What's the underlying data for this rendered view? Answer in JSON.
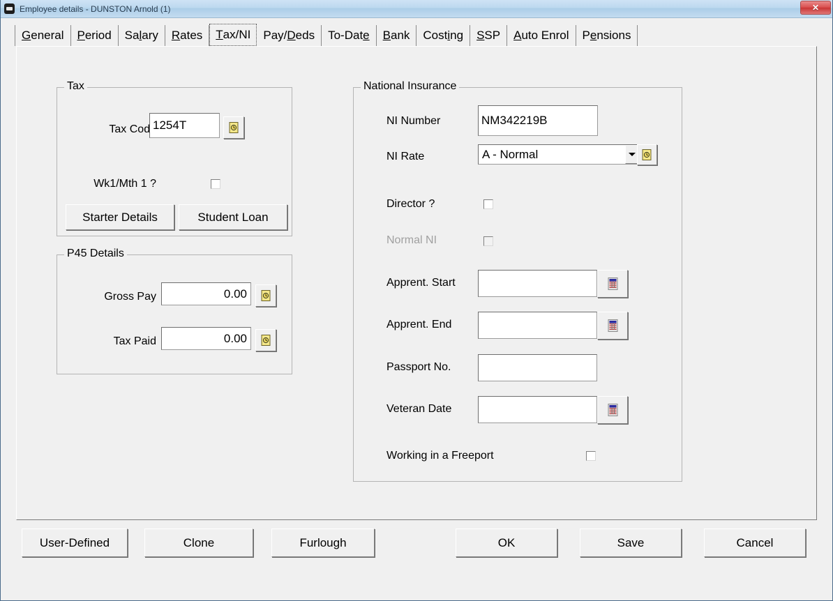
{
  "window": {
    "title": "Employee details - DUNSTON Arnold (1)",
    "icon": "app-icon",
    "close_label": "✕",
    "accent_titlebar": "#bcd8ef",
    "close_color": "#d94f4f"
  },
  "tabs": [
    {
      "label": "General",
      "accel_index": 0,
      "selected": false
    },
    {
      "label": "Period",
      "accel_index": 0,
      "selected": false
    },
    {
      "label": "Salary",
      "accel_index": 2,
      "selected": false
    },
    {
      "label": "Rates",
      "accel_index": 0,
      "selected": false
    },
    {
      "label": "Tax/NI",
      "accel_index": 0,
      "selected": true
    },
    {
      "label": "Pay/Deds",
      "accel_index": 4,
      "selected": false
    },
    {
      "label": "To-Date",
      "accel_index": 6,
      "selected": false
    },
    {
      "label": "Bank",
      "accel_index": 0,
      "selected": false
    },
    {
      "label": "Costing",
      "accel_index": 4,
      "selected": false
    },
    {
      "label": "SSP",
      "accel_index": 0,
      "selected": false
    },
    {
      "label": "Auto Enrol",
      "accel_index": 0,
      "selected": false
    },
    {
      "label": "Pensions",
      "accel_index": 1,
      "selected": false
    }
  ],
  "tax_group": {
    "legend": "Tax",
    "tax_code_label": "Tax Code",
    "tax_code_value": "1254T",
    "tax_code_lookup_icon": "note-lookup-icon",
    "wk1mth1_label": "Wk1/Mth 1 ?",
    "wk1mth1_checked": false,
    "starter_details_label": "Starter Details",
    "student_loan_label": "Student Loan"
  },
  "p45_group": {
    "legend": "P45 Details",
    "gross_pay_label": "Gross Pay",
    "gross_pay_value": "0.00",
    "gross_pay_lookup_icon": "note-lookup-icon",
    "tax_paid_label": "Tax Paid",
    "tax_paid_value": "0.00",
    "tax_paid_lookup_icon": "note-lookup-icon"
  },
  "ni_group": {
    "legend": "National Insurance",
    "ni_number_label": "NI Number",
    "ni_number_value": "NM342219B",
    "ni_rate_label": "NI Rate",
    "ni_rate_value": "A - Normal",
    "ni_rate_lookup_icon": "note-lookup-icon",
    "director_label": "Director ?",
    "director_checked": false,
    "normal_ni_label": "Normal NI",
    "normal_ni_checked": false,
    "normal_ni_disabled": true,
    "apprent_start_label": "Apprent. Start",
    "apprent_start_value": "",
    "apprent_end_label": "Apprent. End",
    "apprent_end_value": "",
    "passport_label": "Passport No.",
    "passport_value": "",
    "veteran_label": "Veteran Date",
    "veteran_value": "",
    "freeport_label": "Working in a Freeport",
    "freeport_checked": false,
    "calendar_icon": "calendar-icon"
  },
  "footer": {
    "user_defined_label": "User-Defined",
    "clone_label": "Clone",
    "furlough_label": "Furlough",
    "ok_label": "OK",
    "save_label": "Save",
    "cancel_label": "Cancel"
  }
}
